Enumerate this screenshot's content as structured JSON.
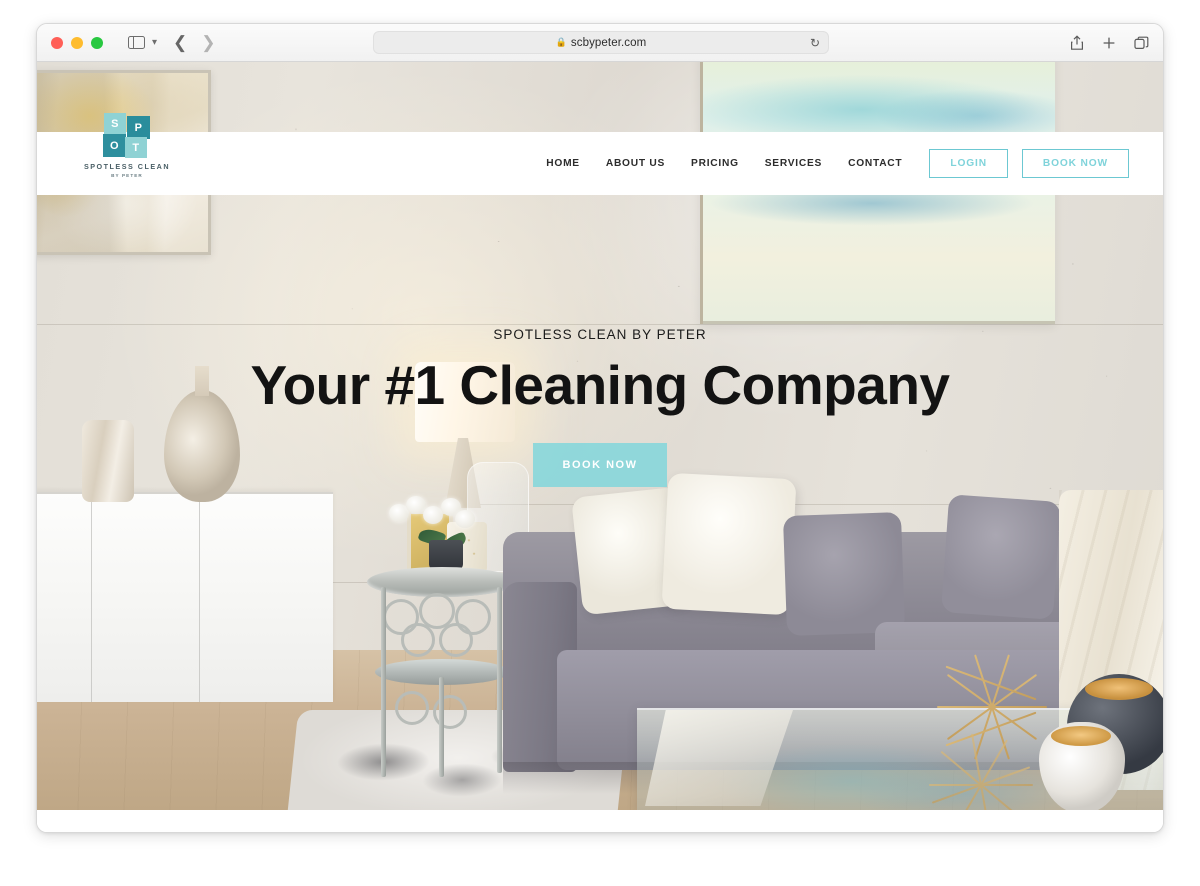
{
  "browser": {
    "url": "scbypeter.com",
    "lock_icon": "lock-icon",
    "reload_icon": "reload-icon",
    "sidebar_icon": "sidebar-toggle-icon",
    "dropdown_icon": "chevron-down-icon",
    "back_icon": "back-arrow-icon",
    "forward_icon": "forward-arrow-icon",
    "share_icon": "share-icon",
    "new_tab_icon": "plus-icon",
    "tabs_icon": "tab-overview-icon",
    "traffic_lights": [
      "close-red",
      "minimize-yellow",
      "zoom-green"
    ]
  },
  "site": {
    "logo": {
      "tiles": [
        "S",
        "P",
        "O",
        "T"
      ],
      "name": "SPOTLESS CLEAN",
      "subtitle": "BY PETER"
    },
    "nav": {
      "links": [
        {
          "label": "HOME"
        },
        {
          "label": "ABOUT US"
        },
        {
          "label": "PRICING"
        },
        {
          "label": "SERVICES"
        },
        {
          "label": "CONTACT"
        }
      ],
      "login_label": "LOGIN",
      "book_label": "BOOK NOW"
    },
    "hero": {
      "eyebrow": "SPOTLESS CLEAN BY PETER",
      "title": "Your #1 Cleaning Company",
      "cta_label": "BOOK NOW",
      "image_alt": "living-room-interior-photo"
    }
  },
  "colors": {
    "brand_teal_light": "#8fd2d4",
    "brand_teal_dark": "#2a8d9c",
    "cta_teal": "#82d6db",
    "nav_text": "#2c2c2c",
    "heading": "#131313"
  }
}
